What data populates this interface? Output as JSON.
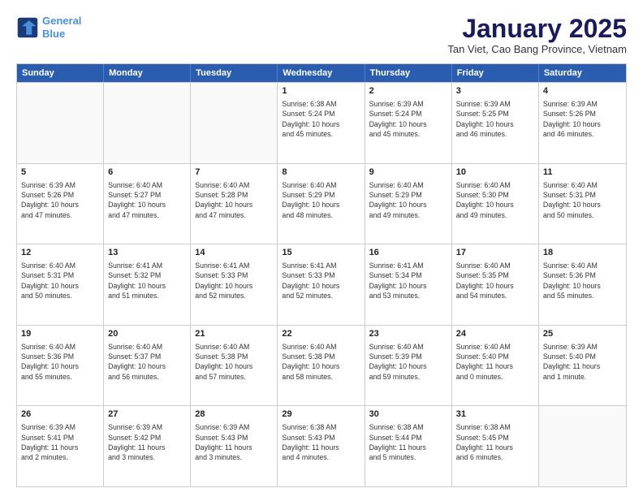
{
  "header": {
    "logo_line1": "General",
    "logo_line2": "Blue",
    "month_title": "January 2025",
    "subtitle": "Tan Viet, Cao Bang Province, Vietnam"
  },
  "weekdays": [
    "Sunday",
    "Monday",
    "Tuesday",
    "Wednesday",
    "Thursday",
    "Friday",
    "Saturday"
  ],
  "rows": [
    [
      {
        "day": "",
        "info": ""
      },
      {
        "day": "",
        "info": ""
      },
      {
        "day": "",
        "info": ""
      },
      {
        "day": "1",
        "info": "Sunrise: 6:38 AM\nSunset: 5:24 PM\nDaylight: 10 hours\nand 45 minutes."
      },
      {
        "day": "2",
        "info": "Sunrise: 6:39 AM\nSunset: 5:24 PM\nDaylight: 10 hours\nand 45 minutes."
      },
      {
        "day": "3",
        "info": "Sunrise: 6:39 AM\nSunset: 5:25 PM\nDaylight: 10 hours\nand 46 minutes."
      },
      {
        "day": "4",
        "info": "Sunrise: 6:39 AM\nSunset: 5:26 PM\nDaylight: 10 hours\nand 46 minutes."
      }
    ],
    [
      {
        "day": "5",
        "info": "Sunrise: 6:39 AM\nSunset: 5:26 PM\nDaylight: 10 hours\nand 47 minutes."
      },
      {
        "day": "6",
        "info": "Sunrise: 6:40 AM\nSunset: 5:27 PM\nDaylight: 10 hours\nand 47 minutes."
      },
      {
        "day": "7",
        "info": "Sunrise: 6:40 AM\nSunset: 5:28 PM\nDaylight: 10 hours\nand 47 minutes."
      },
      {
        "day": "8",
        "info": "Sunrise: 6:40 AM\nSunset: 5:29 PM\nDaylight: 10 hours\nand 48 minutes."
      },
      {
        "day": "9",
        "info": "Sunrise: 6:40 AM\nSunset: 5:29 PM\nDaylight: 10 hours\nand 49 minutes."
      },
      {
        "day": "10",
        "info": "Sunrise: 6:40 AM\nSunset: 5:30 PM\nDaylight: 10 hours\nand 49 minutes."
      },
      {
        "day": "11",
        "info": "Sunrise: 6:40 AM\nSunset: 5:31 PM\nDaylight: 10 hours\nand 50 minutes."
      }
    ],
    [
      {
        "day": "12",
        "info": "Sunrise: 6:40 AM\nSunset: 5:31 PM\nDaylight: 10 hours\nand 50 minutes."
      },
      {
        "day": "13",
        "info": "Sunrise: 6:41 AM\nSunset: 5:32 PM\nDaylight: 10 hours\nand 51 minutes."
      },
      {
        "day": "14",
        "info": "Sunrise: 6:41 AM\nSunset: 5:33 PM\nDaylight: 10 hours\nand 52 minutes."
      },
      {
        "day": "15",
        "info": "Sunrise: 6:41 AM\nSunset: 5:33 PM\nDaylight: 10 hours\nand 52 minutes."
      },
      {
        "day": "16",
        "info": "Sunrise: 6:41 AM\nSunset: 5:34 PM\nDaylight: 10 hours\nand 53 minutes."
      },
      {
        "day": "17",
        "info": "Sunrise: 6:40 AM\nSunset: 5:35 PM\nDaylight: 10 hours\nand 54 minutes."
      },
      {
        "day": "18",
        "info": "Sunrise: 6:40 AM\nSunset: 5:36 PM\nDaylight: 10 hours\nand 55 minutes."
      }
    ],
    [
      {
        "day": "19",
        "info": "Sunrise: 6:40 AM\nSunset: 5:36 PM\nDaylight: 10 hours\nand 55 minutes."
      },
      {
        "day": "20",
        "info": "Sunrise: 6:40 AM\nSunset: 5:37 PM\nDaylight: 10 hours\nand 56 minutes."
      },
      {
        "day": "21",
        "info": "Sunrise: 6:40 AM\nSunset: 5:38 PM\nDaylight: 10 hours\nand 57 minutes."
      },
      {
        "day": "22",
        "info": "Sunrise: 6:40 AM\nSunset: 5:38 PM\nDaylight: 10 hours\nand 58 minutes."
      },
      {
        "day": "23",
        "info": "Sunrise: 6:40 AM\nSunset: 5:39 PM\nDaylight: 10 hours\nand 59 minutes."
      },
      {
        "day": "24",
        "info": "Sunrise: 6:40 AM\nSunset: 5:40 PM\nDaylight: 11 hours\nand 0 minutes."
      },
      {
        "day": "25",
        "info": "Sunrise: 6:39 AM\nSunset: 5:40 PM\nDaylight: 11 hours\nand 1 minute."
      }
    ],
    [
      {
        "day": "26",
        "info": "Sunrise: 6:39 AM\nSunset: 5:41 PM\nDaylight: 11 hours\nand 2 minutes."
      },
      {
        "day": "27",
        "info": "Sunrise: 6:39 AM\nSunset: 5:42 PM\nDaylight: 11 hours\nand 3 minutes."
      },
      {
        "day": "28",
        "info": "Sunrise: 6:39 AM\nSunset: 5:43 PM\nDaylight: 11 hours\nand 3 minutes."
      },
      {
        "day": "29",
        "info": "Sunrise: 6:38 AM\nSunset: 5:43 PM\nDaylight: 11 hours\nand 4 minutes."
      },
      {
        "day": "30",
        "info": "Sunrise: 6:38 AM\nSunset: 5:44 PM\nDaylight: 11 hours\nand 5 minutes."
      },
      {
        "day": "31",
        "info": "Sunrise: 6:38 AM\nSunset: 5:45 PM\nDaylight: 11 hours\nand 6 minutes."
      },
      {
        "day": "",
        "info": ""
      }
    ]
  ]
}
